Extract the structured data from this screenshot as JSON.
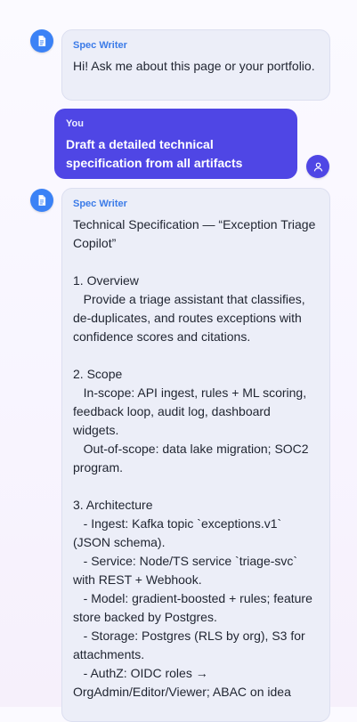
{
  "messages": [
    {
      "role": "bot",
      "sender": "Spec Writer",
      "text": "Hi! Ask me about this page or your portfolio.",
      "avatar_icon": "document-icon"
    },
    {
      "role": "user",
      "sender": "You",
      "text": "Draft a detailed technical specification from all artifacts",
      "avatar_icon": "user-icon"
    },
    {
      "role": "bot",
      "sender": "Spec Writer",
      "text": "Technical Specification — “Exception Triage Copilot”\n\n1. Overview\n   Provide a triage assistant that classifies, de-duplicates, and routes exceptions with confidence scores and citations.\n\n2. Scope\n   In-scope: API ingest, rules + ML scoring, feedback loop, audit log, dashboard widgets.\n   Out-of-scope: data lake migration; SOC2 program.\n\n3. Architecture\n   - Ingest: Kafka topic `exceptions.v1` (JSON schema).\n   - Service: Node/TS service `triage-svc` with REST + Webhook.\n   - Model: gradient-boosted + rules; feature store backed by Postgres.\n   - Storage: Postgres (RLS by org), S3 for attachments.\n   - AuthZ: OIDC roles → OrgAdmin/Editor/Viewer; ABAC on idea",
      "avatar_icon": "document-icon"
    }
  ],
  "colors": {
    "bot_avatar": "#3b82f6",
    "user_bubble": "#4f46e5",
    "bot_bubble": "#eceef8",
    "sender_blue": "#3b7be8"
  }
}
